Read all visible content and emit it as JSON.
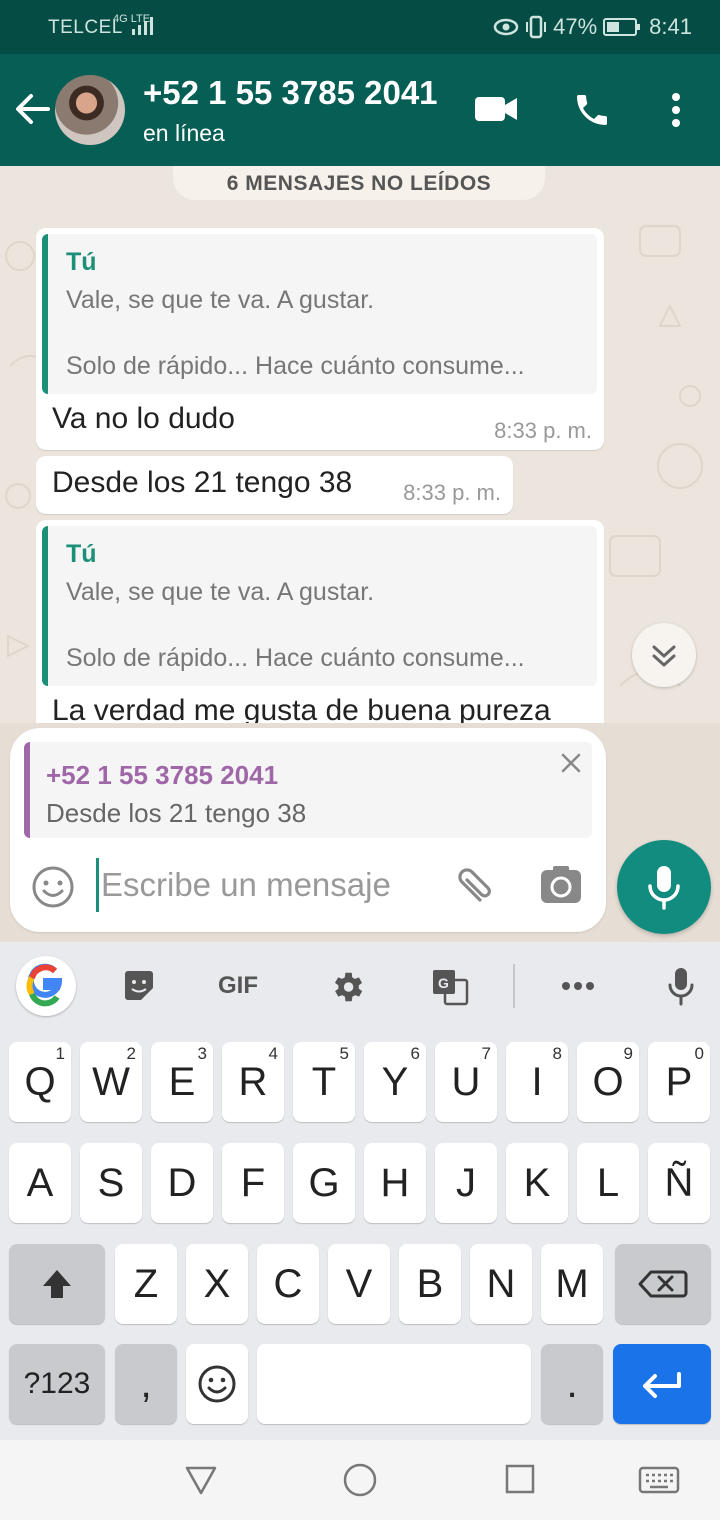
{
  "statusbar": {
    "carrier": "TELCEL",
    "network": "4G LTE",
    "battery_text": "47%",
    "battery_level": 0.47,
    "time": "8:41"
  },
  "header": {
    "contact_name": "+52 1 55 3785 2041",
    "contact_status": "en línea",
    "icons": [
      "back-arrow-icon",
      "video-call-icon",
      "phone-call-icon",
      "more-vert-icon"
    ]
  },
  "chat": {
    "unread_banner": "6 MENSAJES NO LEÍDOS",
    "messages": [
      {
        "quote_author": "Tú",
        "quote_line1": "Vale, se que te va. A gustar.",
        "quote_line2": "Solo de rápido... Hace cuánto consume...",
        "text": "Va no lo dudo",
        "time": "8:33 p. m."
      },
      {
        "text": "Desde los 21 tengo 38",
        "time": "8:33 p. m."
      },
      {
        "quote_author": "Tú",
        "quote_line1": "Vale, se que te va. A gustar.",
        "quote_line2": "Solo de rápido... Hace cuánto consume...",
        "text": "La verdad me gusta de buena pureza"
      }
    ]
  },
  "composer": {
    "reply_author": "+52 1 55 3785 2041",
    "reply_text": "Desde los 21 tengo 38",
    "placeholder": "Escribe un mensaje"
  },
  "keyboard": {
    "toolbar": {
      "gif_label": "GIF"
    },
    "row1": [
      {
        "k": "Q",
        "h": "1"
      },
      {
        "k": "W",
        "h": "2"
      },
      {
        "k": "E",
        "h": "3"
      },
      {
        "k": "R",
        "h": "4"
      },
      {
        "k": "T",
        "h": "5"
      },
      {
        "k": "Y",
        "h": "6"
      },
      {
        "k": "U",
        "h": "7"
      },
      {
        "k": "I",
        "h": "8"
      },
      {
        "k": "O",
        "h": "9"
      },
      {
        "k": "P",
        "h": "0"
      }
    ],
    "row2": [
      "A",
      "S",
      "D",
      "F",
      "G",
      "H",
      "J",
      "K",
      "L",
      "Ñ"
    ],
    "row3": [
      "Z",
      "X",
      "C",
      "V",
      "B",
      "N",
      "M"
    ],
    "symbols_label": "?123",
    "comma_label": ",",
    "period_label": "."
  },
  "colors": {
    "header": "#075e54",
    "statusbar": "#054d44",
    "accent": "#128c7e",
    "quote_bar": "#1b8f77",
    "reply_bar": "#a067a8",
    "enter_key": "#1a73e8"
  }
}
